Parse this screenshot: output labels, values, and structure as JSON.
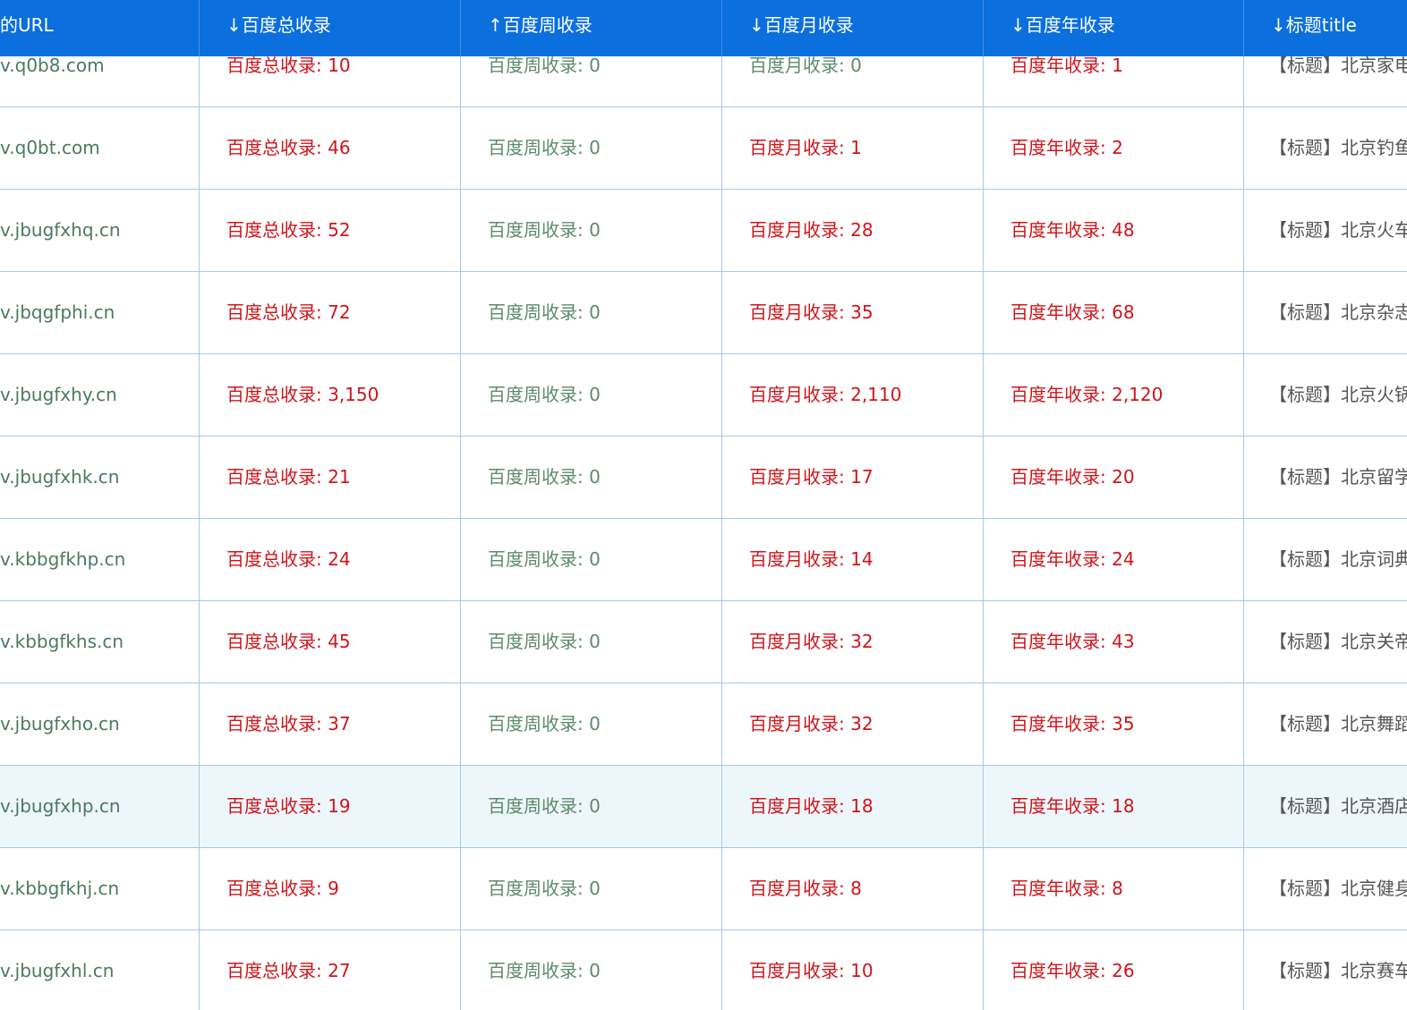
{
  "header": {
    "columns": [
      {
        "arrow": "",
        "label": "的URL"
      },
      {
        "arrow": "↓",
        "label": "百度总收录"
      },
      {
        "arrow": "↑",
        "label": "百度周收录"
      },
      {
        "arrow": "↓",
        "label": "百度月收录"
      },
      {
        "arrow": "↓",
        "label": "百度年收录"
      },
      {
        "arrow": "↓",
        "label": "标题title"
      }
    ]
  },
  "colors": {
    "header_bg": "#0b6fde",
    "value_positive": "#d0141a",
    "value_zero": "#5d8a6a",
    "url_text": "#4b7a5e",
    "highlight_row": "#edf7fb"
  },
  "rows": [
    {
      "url": "v.q0b8.com",
      "total": "百度总收录: 10",
      "week": "百度周收录: 0",
      "month": "百度月收录: 0",
      "year": "百度年收录: 1",
      "title": "【标题】北京家电"
    },
    {
      "url": "v.q0bt.com",
      "total": "百度总收录: 46",
      "week": "百度周收录: 0",
      "month": "百度月收录: 1",
      "year": "百度年收录: 2",
      "title": "【标题】北京钓鱼"
    },
    {
      "url": "v.jbugfxhq.cn",
      "total": "百度总收录: 52",
      "week": "百度周收录: 0",
      "month": "百度月收录: 28",
      "year": "百度年收录: 48",
      "title": "【标题】北京火车"
    },
    {
      "url": "v.jbqgfphi.cn",
      "total": "百度总收录: 72",
      "week": "百度周收录: 0",
      "month": "百度月收录: 35",
      "year": "百度年收录: 68",
      "title": "【标题】北京杂志"
    },
    {
      "url": "v.jbugfxhy.cn",
      "total": "百度总收录: 3,150",
      "week": "百度周收录: 0",
      "month": "百度月收录: 2,110",
      "year": "百度年收录: 2,120",
      "title": "【标题】北京火锅"
    },
    {
      "url": "v.jbugfxhk.cn",
      "total": "百度总收录: 21",
      "week": "百度周收录: 0",
      "month": "百度月收录: 17",
      "year": "百度年收录: 20",
      "title": "【标题】北京留学"
    },
    {
      "url": "v.kbbgfkhp.cn",
      "total": "百度总收录: 24",
      "week": "百度周收录: 0",
      "month": "百度月收录: 14",
      "year": "百度年收录: 24",
      "title": "【标题】北京词典"
    },
    {
      "url": "v.kbbgfkhs.cn",
      "total": "百度总收录: 45",
      "week": "百度周收录: 0",
      "month": "百度月收录: 32",
      "year": "百度年收录: 43",
      "title": "【标题】北京关帝"
    },
    {
      "url": "v.jbugfxho.cn",
      "total": "百度总收录: 37",
      "week": "百度周收录: 0",
      "month": "百度月收录: 32",
      "year": "百度年收录: 35",
      "title": "【标题】北京舞蹈"
    },
    {
      "url": "v.jbugfxhp.cn",
      "total": "百度总收录: 19",
      "week": "百度周收录: 0",
      "month": "百度月收录: 18",
      "year": "百度年收录: 18",
      "title": "【标题】北京酒店",
      "highlight": true
    },
    {
      "url": "v.kbbgfkhj.cn",
      "total": "百度总收录: 9",
      "week": "百度周收录: 0",
      "month": "百度月收录: 8",
      "year": "百度年收录: 8",
      "title": "【标题】北京健身"
    },
    {
      "url": "v.jbugfxhl.cn",
      "total": "百度总收录: 27",
      "week": "百度周收录: 0",
      "month": "百度月收录: 10",
      "year": "百度年收录: 26",
      "title": "【标题】北京赛车"
    }
  ]
}
